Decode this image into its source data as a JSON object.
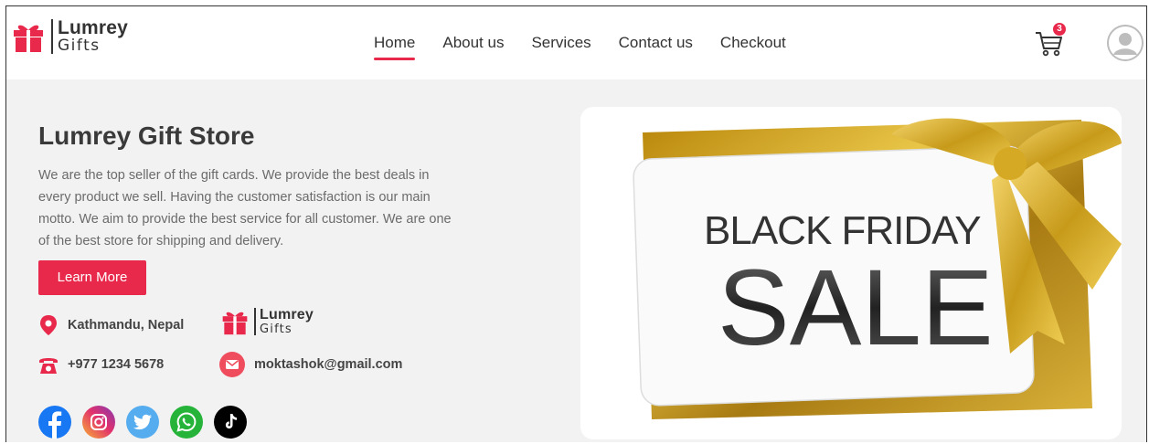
{
  "brand": {
    "name": "Lumrey",
    "sub": "Gifts"
  },
  "nav": [
    {
      "label": "Home",
      "active": true
    },
    {
      "label": "About us"
    },
    {
      "label": "Services"
    },
    {
      "label": "Contact us"
    },
    {
      "label": "Checkout"
    }
  ],
  "cart": {
    "count": "3"
  },
  "hero": {
    "title": "Lumrey Gift Store",
    "description": "We are the top seller of the gift cards. We provide the best deals in every product we sell. Having the customer satisfaction is our main motto. We aim to provide the best service for all customer. We are one of the best store for shipping and delivery.",
    "button": "Learn More"
  },
  "contact": {
    "location": "Kathmandu, Nepal",
    "phone": "+977 1234 5678",
    "email": "moktashok@gmail.com"
  },
  "banner": {
    "line1": "BLACK FRIDAY",
    "line2": "SALE"
  },
  "socials": [
    "facebook-icon",
    "instagram-icon",
    "twitter-icon",
    "whatsapp-icon",
    "tiktok-icon"
  ],
  "colors": {
    "accent": "#e8294b",
    "text": "#3a3a3a",
    "muted": "#6b6b6b",
    "gold": "#c9a227"
  }
}
